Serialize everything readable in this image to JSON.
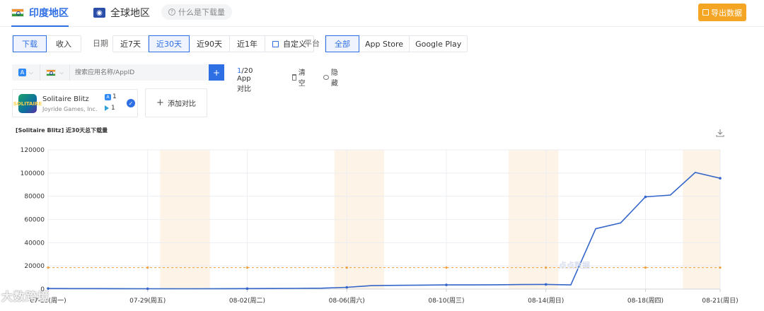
{
  "region_tabs": [
    {
      "label": "印度地区",
      "active": true
    },
    {
      "label": "全球地区",
      "active": false
    }
  ],
  "help_label": "什么是下载量",
  "export_label": "导出数据",
  "metric_toggle": [
    "下载",
    "收入"
  ],
  "date_label": "日期",
  "date_options": [
    "近7天",
    "近30天",
    "近90天",
    "近1年"
  ],
  "date_custom": "自定义",
  "platform_label": "平台",
  "platform_options": [
    "全部",
    "App Store",
    "Google Play"
  ],
  "search": {
    "placeholder": "搜索应用名称/AppID"
  },
  "compare_count": {
    "current": "1",
    "rest": "/20 App对比"
  },
  "clear_label": "清空",
  "hide_label": "隐藏",
  "app": {
    "name": "Solitaire Blitz",
    "developer": "Joyride Games, Inc.",
    "icon_text": "SOLITAIRE",
    "ios_rank": "1",
    "gp_rank": "1"
  },
  "add_compare_label": "添加对比",
  "chart_title": "[Solitaire Blitz]  近30天总下载量",
  "watermark_center": "点点数据",
  "watermark_footer": "大数跨境",
  "colors": {
    "accent": "#2f6fe4",
    "line": "#3465c9",
    "export": "#f5a524",
    "reference": "#f0a040",
    "weekend": "#fdf3e6"
  },
  "chart_data": {
    "type": "line",
    "title": "[Solitaire Blitz]  近30天总下载量",
    "x_tick_labels": [
      "07-25(周一)",
      "07-29(周五)",
      "08-02(周二)",
      "08-06(周六)",
      "08-10(周三)",
      "08-14(周日)",
      "08-18(周四)",
      "08-21(周日)"
    ],
    "y_ticks": [
      0,
      20000,
      40000,
      60000,
      80000,
      100000,
      120000
    ],
    "ylim": [
      0,
      120000
    ],
    "series": [
      {
        "x": [
          "07-25",
          "07-26",
          "07-27",
          "07-28",
          "07-29",
          "07-30",
          "07-31",
          "08-01",
          "08-02",
          "08-03",
          "08-04",
          "08-05",
          "08-06",
          "08-07",
          "08-08",
          "08-09",
          "08-10",
          "08-11",
          "08-12",
          "08-13",
          "08-14",
          "08-15",
          "08-16",
          "08-17",
          "08-18",
          "08-19",
          "08-20",
          "08-21"
        ],
        "values": [
          500,
          450,
          400,
          350,
          300,
          300,
          320,
          350,
          400,
          500,
          600,
          800,
          1500,
          3000,
          3200,
          3400,
          3600,
          3600,
          3700,
          3900,
          4000,
          3600,
          52000,
          57000,
          79500,
          81000,
          100500,
          95500
        ]
      }
    ],
    "reference_line": 18500,
    "weekend_bands": [
      [
        "07-30",
        "07-31"
      ],
      [
        "08-06",
        "08-07"
      ],
      [
        "08-13",
        "08-14"
      ],
      [
        "08-20",
        "08-21"
      ]
    ],
    "grid": true
  }
}
